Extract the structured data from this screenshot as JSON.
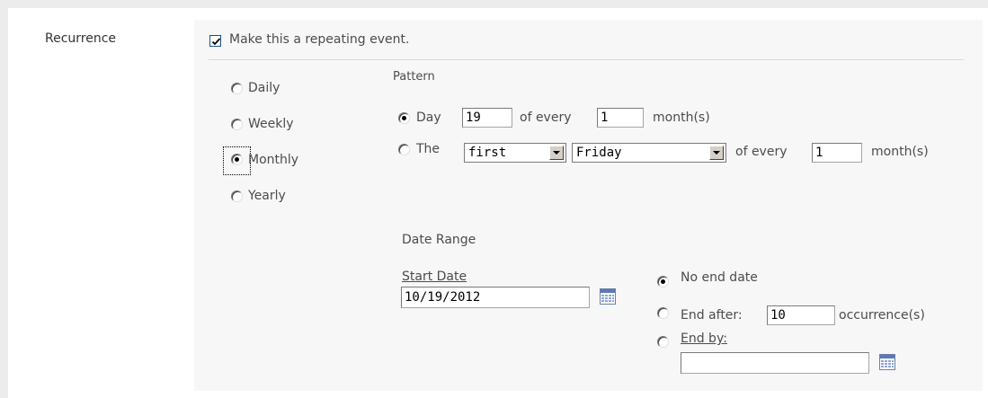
{
  "recurrence": {
    "label": "Recurrence",
    "repeat_checkbox": {
      "label": "Make this a repeating event.",
      "checked": true
    }
  },
  "frequency": {
    "options": [
      {
        "label": "Daily",
        "selected": false
      },
      {
        "label": "Weekly",
        "selected": false
      },
      {
        "label": "Monthly",
        "selected": true
      },
      {
        "label": "Yearly",
        "selected": false
      }
    ]
  },
  "pattern": {
    "heading": "Pattern",
    "day_option": {
      "selected": true,
      "prefix": "Day",
      "day_value": "19",
      "middle": "of every",
      "every_value": "1",
      "suffix": "month(s)"
    },
    "the_option": {
      "selected": false,
      "prefix": "The",
      "ordinal_value": "first",
      "weekday_value": "Friday",
      "middle": "of every",
      "every_value": "1",
      "suffix": "month(s)"
    }
  },
  "date_range": {
    "heading": "Date Range",
    "start_date_label": "Start Date",
    "start_date_value": "10/19/2012",
    "no_end": {
      "label": "No end date",
      "selected": true
    },
    "end_after": {
      "label": "End after:",
      "value": "10",
      "suffix": "occurrence(s)",
      "selected": false
    },
    "end_by": {
      "label": "End by:",
      "value": "",
      "selected": false
    }
  },
  "icons": {
    "calendar": "calendar-icon"
  }
}
